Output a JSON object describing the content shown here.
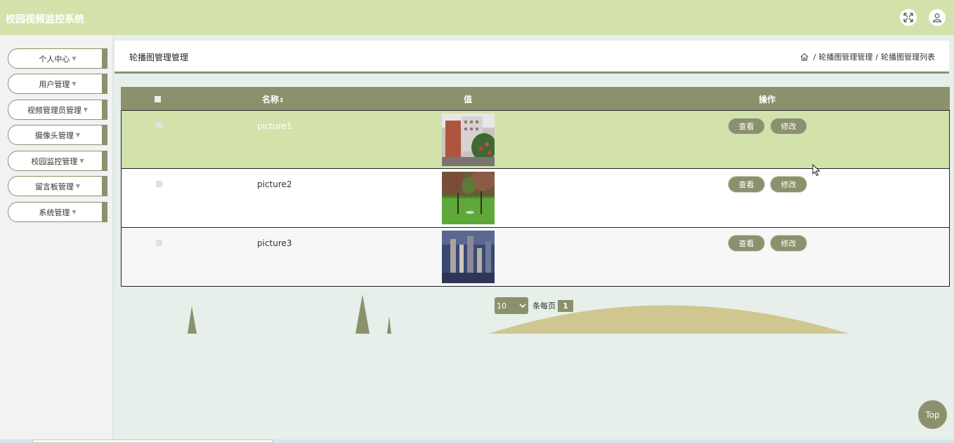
{
  "app": {
    "title": "校园视频监控系统"
  },
  "header": {
    "icons": [
      "fullscreen-icon",
      "user-icon"
    ]
  },
  "sidebar": {
    "items": [
      {
        "label": "个人中心"
      },
      {
        "label": "用户管理"
      },
      {
        "label": "视频管理员管理"
      },
      {
        "label": "摄像头管理"
      },
      {
        "label": "校园监控管理"
      },
      {
        "label": "留言板管理"
      },
      {
        "label": "系统管理"
      }
    ]
  },
  "breadcrumb": {
    "page_title": "轮播图管理管理",
    "home_icon": "home-icon",
    "separator": "/",
    "level1": "轮播图管理管理",
    "level2": "轮播图管理列表"
  },
  "table": {
    "headers": {
      "name": "名称",
      "sort_icon": "⇕",
      "value": "值",
      "actions": "操作"
    },
    "rows": [
      {
        "name": "picture1",
        "image": "campus-building-photo",
        "view": "查看",
        "edit": "修改"
      },
      {
        "name": "picture2",
        "image": "campus-lawn-photo",
        "view": "查看",
        "edit": "修改"
      },
      {
        "name": "picture3",
        "image": "city-buildings-photo",
        "view": "查看",
        "edit": "修改"
      }
    ]
  },
  "pagination": {
    "page_size": "10",
    "per_page_label": "条每页",
    "current_page": "1"
  },
  "top_button": {
    "label": "Top"
  },
  "colors": {
    "header_bg": "#d3e2ab",
    "accent": "#8b916c",
    "page_bg": "#e6efe9",
    "highlight_row": "#d3e2ab"
  }
}
